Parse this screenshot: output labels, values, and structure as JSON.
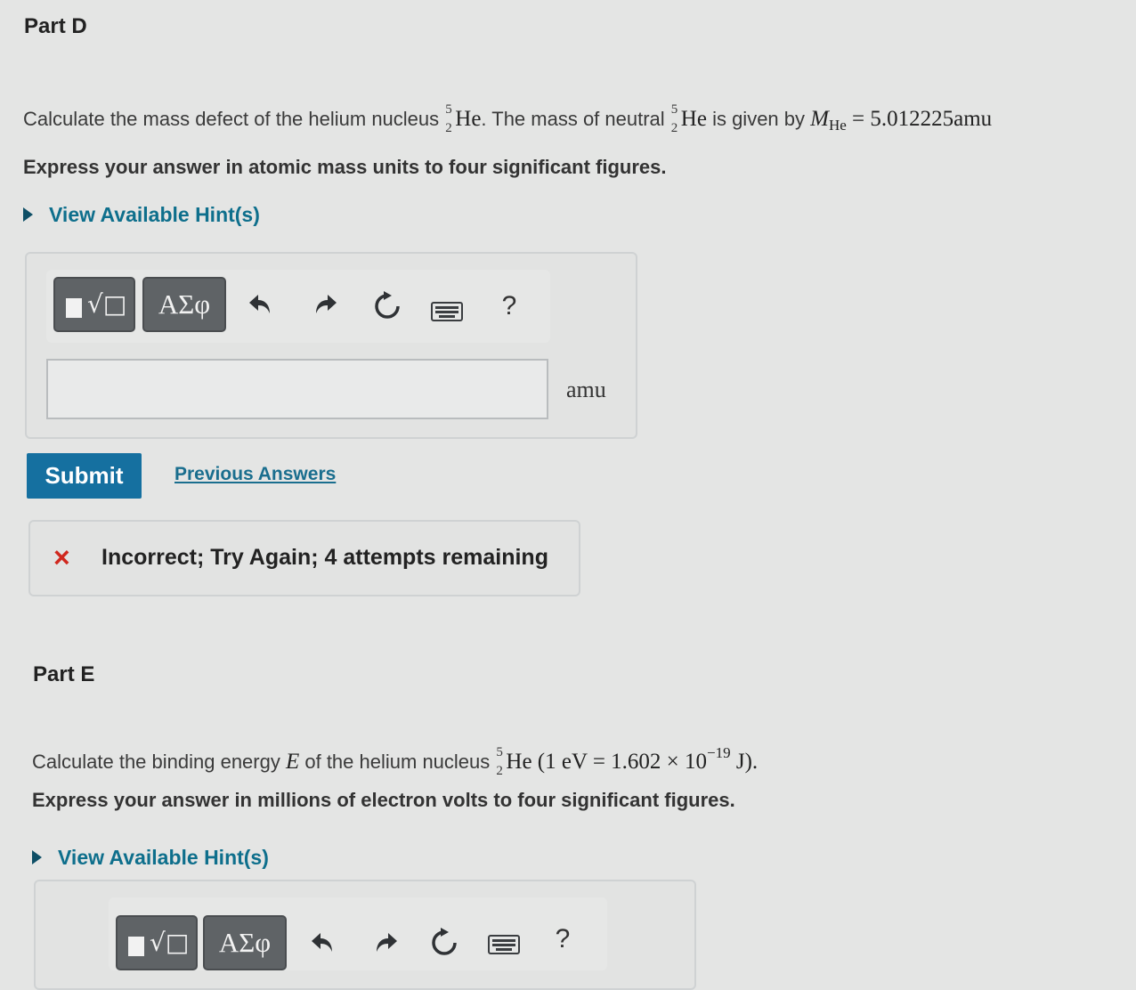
{
  "part_d": {
    "title": "Part D",
    "q_pre": "Calculate the mass defect of the helium nucleus ",
    "nucleus_sup": "5",
    "nucleus_sub": "2",
    "nucleus_sym": "He",
    "q_mid": ". The mass of neutral ",
    "q_post": " is given by ",
    "mass_symbol": "M",
    "mass_sub": "He",
    "mass_value": " = 5.012225amu",
    "instruction": "Express your answer in atomic mass units to four significant figures.",
    "hint": "View Available Hint(s)",
    "toolbar": {
      "templates_glyph": "√□",
      "symbols_label": "ΑΣφ",
      "help_label": "?"
    },
    "input_value": "",
    "unit": "amu",
    "submit": "Submit",
    "previous_answers": "Previous Answers",
    "feedback": "Incorrect; Try Again; 4 attempts remaining",
    "feedback_icon": "×"
  },
  "part_e": {
    "title": "Part E",
    "q_pre": "Calculate the binding energy ",
    "energy_symbol": "E",
    "q_mid": " of the helium nucleus ",
    "nucleus_sup": "5",
    "nucleus_sub": "2",
    "nucleus_sym": "He",
    "conversion": " (1 eV = 1.602 × 10",
    "exponent": "−19",
    "conversion_end": " J).",
    "instruction": "Express your answer in millions of electron volts to four significant figures.",
    "hint": "View Available Hint(s)",
    "toolbar": {
      "templates_glyph": "√□",
      "symbols_label": "ΑΣφ",
      "help_label": "?"
    }
  },
  "colors": {
    "accent": "#1570a0",
    "link": "#0e6f8c",
    "error": "#d0281e",
    "background": "#e4e5e4"
  },
  "icons": [
    "triangle-right-icon",
    "undo-icon",
    "redo-icon",
    "reset-icon",
    "keyboard-icon",
    "help-icon",
    "close-icon"
  ]
}
